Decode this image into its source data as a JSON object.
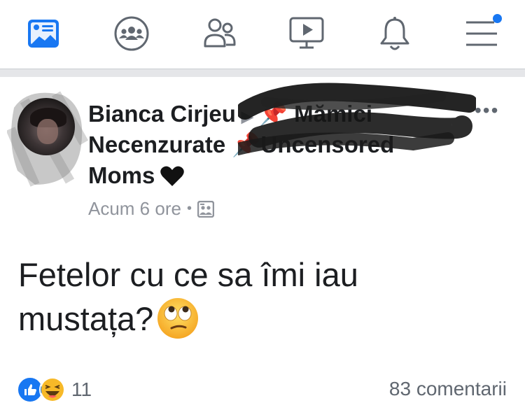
{
  "nav": {
    "items": [
      {
        "name": "news-feed",
        "icon": "newsfeed-icon",
        "active": true
      },
      {
        "name": "groups",
        "icon": "groups-icon"
      },
      {
        "name": "friends",
        "icon": "friends-icon"
      },
      {
        "name": "watch",
        "icon": "watch-icon"
      },
      {
        "name": "notifications",
        "icon": "bell-icon"
      },
      {
        "name": "menu",
        "icon": "hamburger-icon",
        "badge": true
      }
    ],
    "accent_color": "#1877f2"
  },
  "post": {
    "author": "Bianca Cirjeu",
    "group_line1": "Mămici",
    "group_line2a": "Necenzurate",
    "group_line2b": "Uncensored",
    "group_line3": "Moms",
    "timestamp": "Acum 6 ore",
    "text_line1": "Fetelor cu ce sa îmi iau",
    "text_line2": "mustața?",
    "emoji": "face-with-rolling-eyes",
    "reaction_count": "11",
    "comments": "83 comentarii",
    "reaction_types": [
      "like",
      "haha"
    ]
  }
}
